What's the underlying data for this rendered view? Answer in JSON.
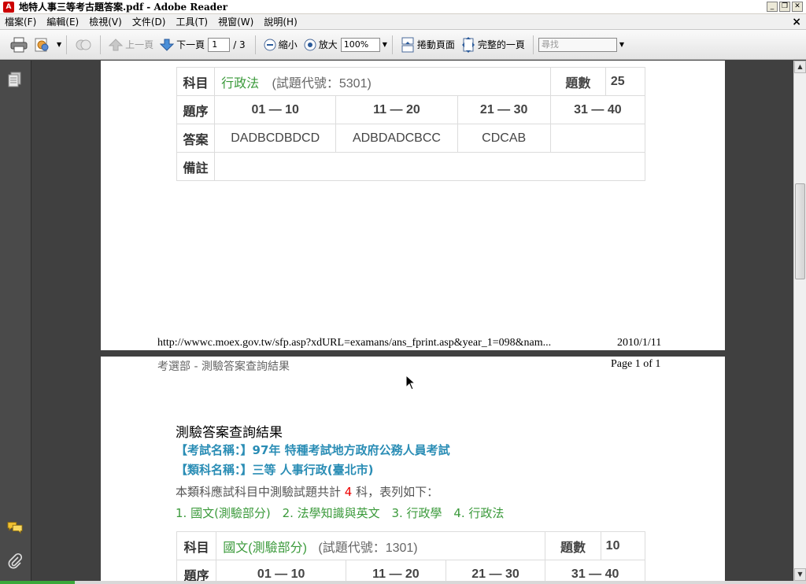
{
  "window": {
    "title": "地特人事三等考古題答案.pdf - Adobe Reader",
    "app_icon": "A",
    "controls": {
      "minimize": "_",
      "restore": "❐",
      "close": "✕"
    }
  },
  "menu": {
    "items": [
      "檔案(F)",
      "編輯(E)",
      "檢視(V)",
      "文件(D)",
      "工具(T)",
      "視窗(W)",
      "說明(H)"
    ],
    "close": "×"
  },
  "toolbar": {
    "prev_page": "上一頁",
    "next_page": "下一頁",
    "current_page": "1",
    "total_pages": "/ 3",
    "zoom_out": "縮小",
    "zoom_in": "放大",
    "zoom_level": "100%",
    "scrolling": "捲動頁面",
    "full_page": "完整的一頁",
    "search_placeholder": "尋找"
  },
  "page1": {
    "subject_label": "科目",
    "subject_name": "行政法",
    "subject_code": "(試題代號：5301)",
    "count_label": "題數",
    "count_value": "25",
    "seq_label": "題序",
    "seq": [
      "01 — 10",
      "11 — 20",
      "21 — 30",
      "31 — 40"
    ],
    "answer_label": "答案",
    "answers": [
      "DADBCDBDCD",
      "ADBDADCBCC",
      "CDCAB",
      ""
    ],
    "remark_label": "備註",
    "footer_url": "http://wwwc.moex.gov.tw/sfp.asp?xdURL=examans/ans_fprint.asp&year_1=098&nam...",
    "footer_date": "2010/1/11"
  },
  "page2": {
    "header_left": "考選部 - 測驗答案查詢結果",
    "header_right": "Page 1 of 1",
    "title": "測驗答案查詢結果",
    "exam_label": "【考試名稱：】",
    "exam_value": "97年 特種考試地方政府公務人員考試",
    "category_label": "【類科名稱：】",
    "category_value": "三等 人事行政(臺北市)",
    "summary_prefix": "本類科應試科目中測驗試題共計",
    "summary_count": "4",
    "summary_suffix": "科，表列如下：",
    "subjects": [
      "1. 國文(測驗部分)",
      "2. 法學知識與英文",
      "3. 行政學",
      "4. 行政法"
    ],
    "table": {
      "subject_label": "科目",
      "subject_name": "國文(測驗部分)",
      "subject_code": "(試題代號：1301)",
      "count_label": "題數",
      "count_value": "10",
      "seq_label": "題序",
      "seq": [
        "01 — 10",
        "11 — 20",
        "21 — 30",
        "31 — 40"
      ]
    }
  },
  "colors": {
    "accent_teal": "#2a8db5",
    "subject_green": "#3b9a3b",
    "count_red": "#e00000"
  },
  "icons": [
    "print-icon",
    "pages-icon",
    "comment-icon",
    "attachment-icon",
    "up-arrow-icon",
    "down-arrow-icon",
    "zoom-out-icon",
    "zoom-in-icon",
    "scroll-icon",
    "fit-page-icon"
  ]
}
